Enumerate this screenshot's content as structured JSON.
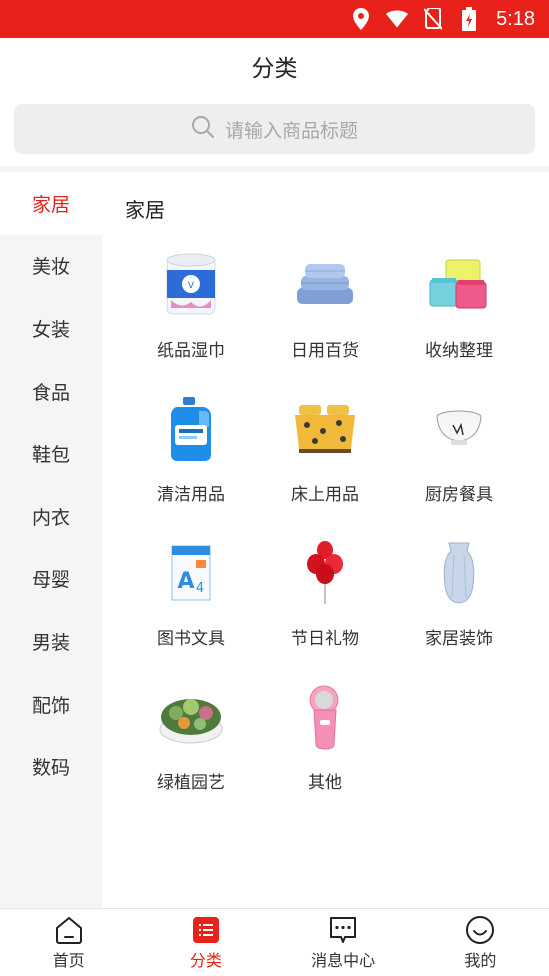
{
  "status_bar": {
    "time": "5:18",
    "icons": [
      "location-icon",
      "wifi-icon",
      "no-sim-icon",
      "battery-charging-icon"
    ]
  },
  "header": {
    "title": "分类"
  },
  "search": {
    "placeholder": "请输入商品标题",
    "icon": "search-icon"
  },
  "sidebar": {
    "items": [
      {
        "label": "家居",
        "active": true
      },
      {
        "label": "美妆"
      },
      {
        "label": "女装"
      },
      {
        "label": "食品"
      },
      {
        "label": "鞋包"
      },
      {
        "label": "内衣"
      },
      {
        "label": "母婴"
      },
      {
        "label": "男装"
      },
      {
        "label": "配饰"
      },
      {
        "label": "数码"
      }
    ]
  },
  "content": {
    "section_title": "家居",
    "items": [
      {
        "label": "纸品湿巾",
        "icon": "tissue-roll-icon"
      },
      {
        "label": "日用百货",
        "icon": "towel-icon"
      },
      {
        "label": "收纳整理",
        "icon": "storage-box-icon"
      },
      {
        "label": "清洁用品",
        "icon": "detergent-bottle-icon"
      },
      {
        "label": "床上用品",
        "icon": "bedding-icon"
      },
      {
        "label": "厨房餐具",
        "icon": "bowl-icon"
      },
      {
        "label": "图书文具",
        "icon": "a4-paper-icon"
      },
      {
        "label": "节日礼物",
        "icon": "balloons-icon"
      },
      {
        "label": "家居装饰",
        "icon": "vase-icon"
      },
      {
        "label": "绿植园艺",
        "icon": "succulent-pot-icon"
      },
      {
        "label": "其他",
        "icon": "lint-remover-icon"
      }
    ]
  },
  "bottom_nav": {
    "items": [
      {
        "label": "首页",
        "icon": "home-icon"
      },
      {
        "label": "分类",
        "icon": "category-list-icon",
        "active": true
      },
      {
        "label": "消息中心",
        "icon": "message-icon"
      },
      {
        "label": "我的",
        "icon": "smile-face-icon"
      }
    ]
  },
  "colors": {
    "accent": "#e8221b",
    "sidebar_bg": "#f5f5f5",
    "search_bg": "#eeeeee",
    "text": "#333333"
  }
}
